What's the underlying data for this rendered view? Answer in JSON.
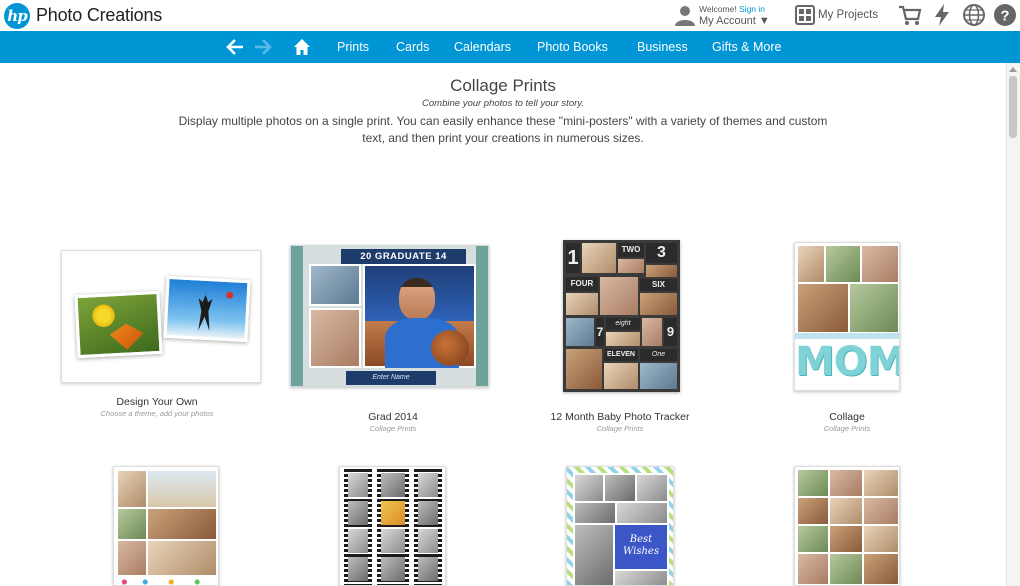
{
  "header": {
    "brand": "Photo Creations",
    "logo_text": "hp",
    "welcome": "Welcome!",
    "sign_in": "Sign in",
    "my_account": "My Account ▼",
    "my_projects": "My Projects"
  },
  "nav": {
    "items": [
      "Prints",
      "Cards",
      "Calendars",
      "Photo Books",
      "Business",
      "Gifts & More"
    ]
  },
  "page": {
    "title": "Collage Prints",
    "subtitle": "Combine your photos to tell your story.",
    "description": "Display multiple photos on a single print. You can easily enhance these \"mini-posters\" with a variety of themes and custom text, and then print your creations in numerous sizes."
  },
  "products": [
    {
      "name": "Design Your Own",
      "category": "Choose a theme, add your photos"
    },
    {
      "name": "Grad 2014",
      "category": "Collage Prints",
      "banner": "20 GRADUATE 14",
      "field": "Enter Name"
    },
    {
      "name": "12 Month Baby Photo Tracker",
      "category": "Collage Prints",
      "labels": [
        "1",
        "TWO",
        "3",
        "FOUR",
        "SIX",
        "7",
        "eight",
        "9",
        "ELEVEN",
        "One"
      ]
    },
    {
      "name": "Collage",
      "category": "Collage Prints",
      "overlay": "MOM"
    },
    {
      "name": "",
      "category": ""
    },
    {
      "name": "",
      "category": ""
    },
    {
      "name": "",
      "category": "",
      "overlay": "Best Wishes"
    },
    {
      "name": "",
      "category": ""
    }
  ],
  "colors": {
    "brand_blue": "#0096d6",
    "text": "#333333",
    "muted": "#999999"
  },
  "icons": [
    "user-icon",
    "projects-icon",
    "cart-icon",
    "flash-icon",
    "globe-icon",
    "help-icon",
    "back-arrow-icon",
    "forward-arrow-icon",
    "home-icon"
  ]
}
